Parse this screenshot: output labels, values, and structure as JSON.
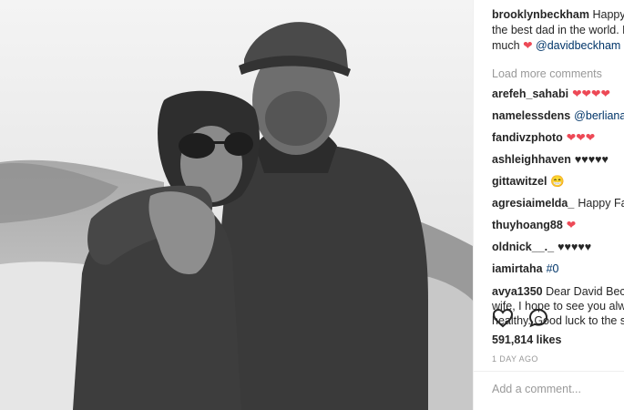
{
  "caption": {
    "username": "brooklynbeckham",
    "text_line1": "Happy F",
    "text_line2": "the best dad in the world. L",
    "text_line3_pre": "much",
    "heart": "❤",
    "mention": "@davidbeckham"
  },
  "load_more": "Load more comments",
  "comments": [
    {
      "username": "arefeh_sahabi",
      "text": "❤❤❤❤",
      "kind": "heart"
    },
    {
      "username": "namelessdens",
      "text": "@berlianapt",
      "kind": "mention"
    },
    {
      "username": "fandivzphoto",
      "text": "❤❤❤",
      "kind": "heart"
    },
    {
      "username": "ashleighhaven",
      "text": "♥♥♥♥♥",
      "kind": "plain"
    },
    {
      "username": "gittawitzel",
      "text": "😁",
      "kind": "plain"
    },
    {
      "username": "agresiaimelda_",
      "text": "Happy Fath",
      "kind": "plain"
    },
    {
      "username": "thuyhoang88",
      "text": "❤",
      "kind": "heart"
    },
    {
      "username": "oldnick__._",
      "text": "♥♥♥♥♥",
      "kind": "plain"
    },
    {
      "username": "iamirtaha",
      "text": "#0",
      "kind": "mention"
    }
  ],
  "long_comment": {
    "username": "avya1350",
    "line1": "Dear David Beckham",
    "line2": "wife, I hope to see you alwa",
    "line3": "healthy. Good luck to the st"
  },
  "likes": "591,814 likes",
  "time": "1 DAY AGO",
  "add_comment_placeholder": "Add a comment...",
  "icons": [
    "heart-outline-icon",
    "comment-bubble-icon"
  ]
}
